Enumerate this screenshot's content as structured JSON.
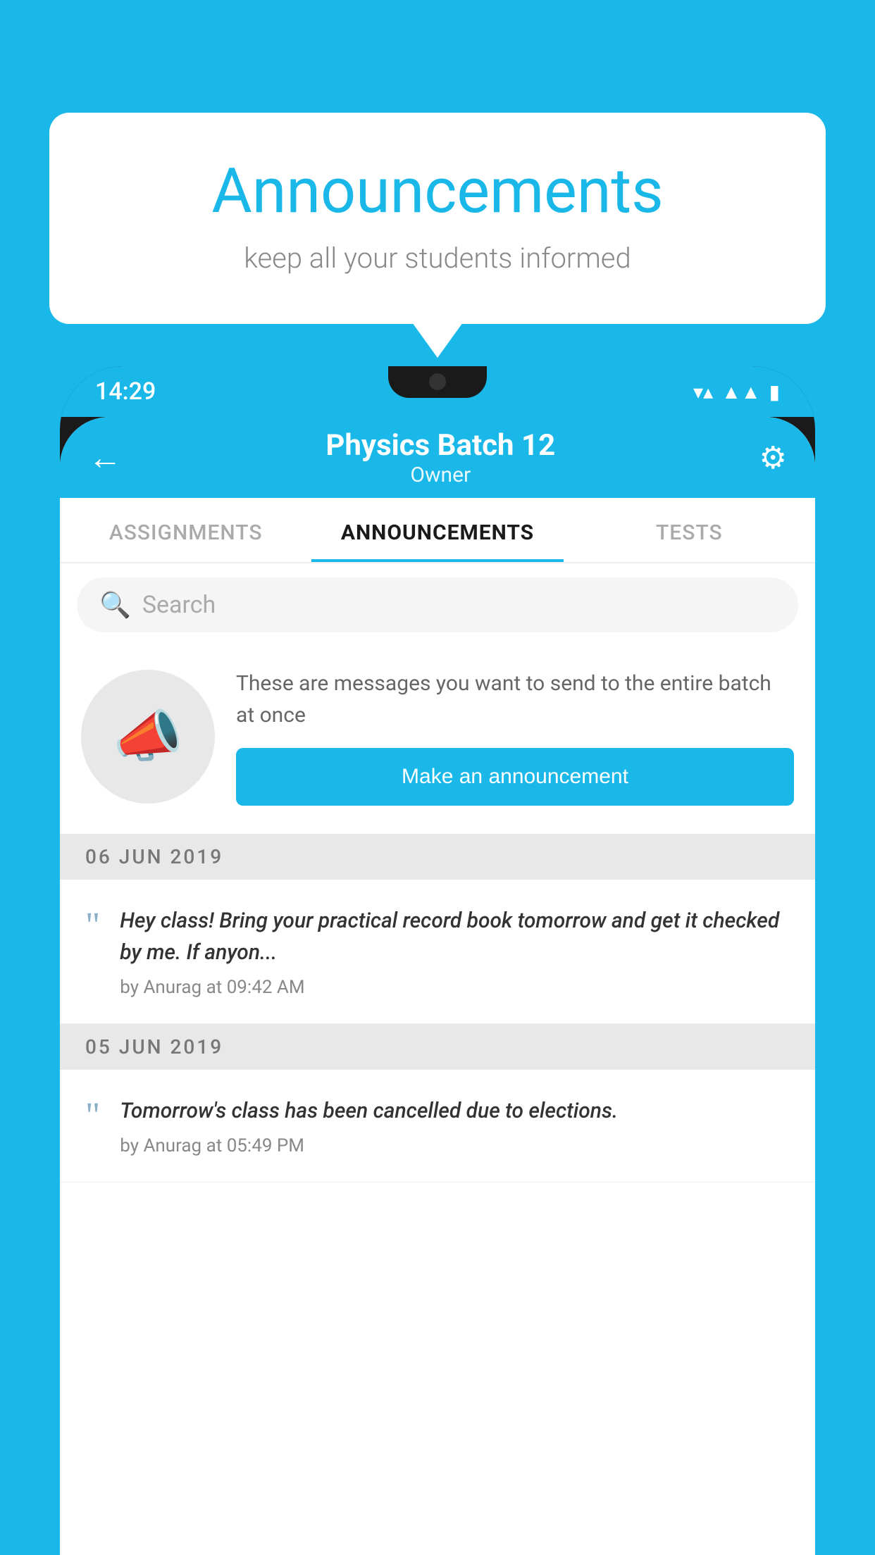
{
  "background_color": "#1ab8e8",
  "speech_bubble": {
    "title": "Announcements",
    "subtitle": "keep all your students informed"
  },
  "status_bar": {
    "time": "14:29",
    "icons": [
      "wifi",
      "signal",
      "battery"
    ]
  },
  "app_header": {
    "title": "Physics Batch 12",
    "subtitle": "Owner",
    "back_label": "←",
    "gear_label": "⚙"
  },
  "tabs": [
    {
      "label": "ASSIGNMENTS",
      "active": false
    },
    {
      "label": "ANNOUNCEMENTS",
      "active": true
    },
    {
      "label": "TESTS",
      "active": false
    }
  ],
  "search": {
    "placeholder": "Search"
  },
  "promo": {
    "description": "These are messages you want to send to the entire batch at once",
    "button_label": "Make an announcement"
  },
  "announcements": [
    {
      "date": "06  JUN  2019",
      "text": "Hey class! Bring your practical record book tomorrow and get it checked by me. If anyon...",
      "by": "by Anurag at 09:42 AM"
    },
    {
      "date": "05  JUN  2019",
      "text": "Tomorrow's class has been cancelled due to elections.",
      "by": "by Anurag at 05:49 PM"
    }
  ]
}
